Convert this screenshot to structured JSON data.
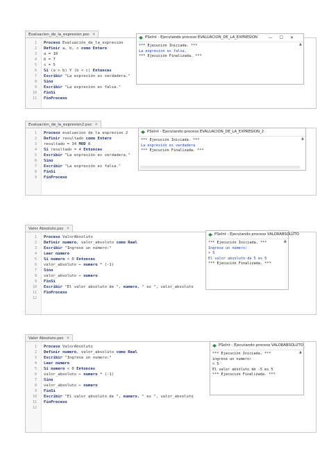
{
  "panels": [
    {
      "tab": "Evaluacion_de_la_expresion.psc",
      "lines": [
        [
          "1",
          [
            [
              "k",
              "Proceso"
            ],
            [
              "t",
              " Evaluación_de_la_expresión"
            ]
          ]
        ],
        [
          "2",
          [
            [
              "t",
              "    "
            ],
            [
              "k",
              "Definir"
            ],
            [
              "t",
              " a, b, c "
            ],
            [
              "k",
              "como Entero"
            ]
          ]
        ],
        [
          "3",
          [
            [
              "t",
              "    a = 10"
            ]
          ]
        ],
        [
          "4",
          [
            [
              "t",
              "    b = 7"
            ]
          ]
        ],
        [
          "5",
          [
            [
              "t",
              "    c = 5"
            ]
          ]
        ],
        [
          "6",
          [
            [
              "t",
              "    "
            ],
            [
              "k",
              "Si"
            ],
            [
              "t",
              " (a > b) Y (b < c) "
            ],
            [
              "k",
              "Entonces"
            ]
          ]
        ],
        [
          "7",
          [
            [
              "t",
              "        "
            ],
            [
              "k",
              "Escribir"
            ],
            [
              "t",
              " \"La expresión es verdadera.\""
            ]
          ]
        ],
        [
          "8",
          [
            [
              "t",
              "    "
            ],
            [
              "k",
              "Sino"
            ]
          ]
        ],
        [
          "9",
          [
            [
              "t",
              "        "
            ],
            [
              "k",
              "Escribir"
            ],
            [
              "t",
              " \"La expresión es falsa.\""
            ]
          ]
        ],
        [
          "10",
          [
            [
              "t",
              "    "
            ],
            [
              "k",
              "FinSi"
            ]
          ]
        ],
        [
          "11",
          [
            [
              "k",
              "FinProceso"
            ]
          ]
        ]
      ],
      "output": {
        "title": "PSeInt - Ejecutando proceso EVALUACION_DE_LA_EXPRESION",
        "lines": [
          [
            "*** Ejecución Iniciada. ***",
            "n"
          ],
          [
            "La expresión es falsa.",
            "b"
          ],
          [
            "*** Ejecución Finalizada. ***",
            "n"
          ]
        ]
      }
    },
    {
      "tab": "Evaluacion_de_la_expresion2.psc",
      "lines": [
        [
          "1",
          [
            [
              "k",
              "Proceso"
            ],
            [
              "t",
              " evaluacion de la expresion 2"
            ]
          ]
        ],
        [
          "2",
          [
            [
              "t",
              "    "
            ],
            [
              "k",
              "Definir"
            ],
            [
              "t",
              " resultado "
            ],
            [
              "k",
              "como Entero"
            ]
          ]
        ],
        [
          "3",
          [
            [
              "t",
              "    resultado = 34 "
            ],
            [
              "k",
              "MOD"
            ],
            [
              "t",
              " 6"
            ]
          ]
        ],
        [
          "4",
          [
            [
              "t",
              "    "
            ],
            [
              "k",
              "Si"
            ],
            [
              "t",
              " resultado = 4 "
            ],
            [
              "k",
              "Entonces"
            ]
          ]
        ],
        [
          "5",
          [
            [
              "t",
              "        "
            ],
            [
              "k",
              "Escribir"
            ],
            [
              "t",
              " \"La expresión es verdadera.\""
            ]
          ]
        ],
        [
          "6",
          [
            [
              "t",
              "    "
            ],
            [
              "k",
              "Sino"
            ]
          ]
        ],
        [
          "7",
          [
            [
              "t",
              "        "
            ],
            [
              "k",
              "Escribir"
            ],
            [
              "t",
              " \"La expresión es falsa.\""
            ]
          ]
        ],
        [
          "8",
          [
            [
              "t",
              "    "
            ],
            [
              "k",
              "FinSi"
            ]
          ]
        ],
        [
          "9",
          [
            [
              "k",
              "FinProceso"
            ]
          ]
        ]
      ],
      "output": {
        "title": "PSeInt - Ejecutando proceso EVALUACION_DE_LA_EXPRESION_2",
        "lines": [
          [
            "*** Ejecución Iniciada. ***",
            "n"
          ],
          [
            "La expresión es verdadera",
            "b"
          ],
          [
            "*** Ejecución Finalizada. ***",
            "n"
          ]
        ]
      }
    },
    {
      "tab": "Valor Absoluto.psc",
      "lines": [
        [
          "1",
          [
            [
              "k",
              "Proceso"
            ],
            [
              "t",
              " ValorAbsoluto"
            ]
          ]
        ],
        [
          "2",
          [
            [
              "t",
              "    "
            ],
            [
              "k",
              "Definir"
            ],
            [
              "t",
              " "
            ],
            [
              "k",
              "numero"
            ],
            [
              "t",
              ", valor_absoluto "
            ],
            [
              "k",
              "como Real"
            ]
          ]
        ],
        [
          "3",
          [
            [
              "t",
              "    "
            ],
            [
              "k",
              "Escribir"
            ],
            [
              "t",
              " \"Ingrese un número:\""
            ]
          ]
        ],
        [
          "4",
          [
            [
              "t",
              "    "
            ],
            [
              "k",
              "Leer numero"
            ]
          ]
        ],
        [
          "5",
          [
            [
              "t",
              "    "
            ],
            [
              "k",
              "Si numero"
            ],
            [
              "t",
              " < 0 "
            ],
            [
              "k",
              "Entonces"
            ]
          ]
        ],
        [
          "6",
          [
            [
              "t",
              "    valor_absoluto ← "
            ],
            [
              "k",
              "numero"
            ],
            [
              "t",
              " * (-1)"
            ]
          ]
        ],
        [
          "7",
          [
            [
              "t",
              "    "
            ],
            [
              "k",
              "Sino"
            ]
          ]
        ],
        [
          "8",
          [
            [
              "t",
              "    valor_absoluto ← "
            ],
            [
              "k",
              "numero"
            ]
          ]
        ],
        [
          "9",
          [
            [
              "t",
              "    "
            ],
            [
              "k",
              "FinSi"
            ]
          ]
        ],
        [
          "10",
          [
            [
              "t",
              "    "
            ],
            [
              "k",
              "Escribir"
            ],
            [
              "t",
              " \"El valor absoluto de \", "
            ],
            [
              "k",
              "numero"
            ],
            [
              "t",
              ", \" es \", valor_absoluto"
            ]
          ]
        ],
        [
          "11",
          [
            [
              "k",
              "FinProceso"
            ]
          ]
        ],
        [
          "12",
          []
        ]
      ],
      "output": {
        "title": "PSeInt - Ejecutando proceso VALORABSOLUTO",
        "lines": [
          [
            "*** Ejecución Iniciada. ***",
            "n"
          ],
          [
            "Ingrese un número:",
            "b"
          ],
          [
            "> 5",
            "b"
          ],
          [
            "El valor absoluto de 5 es 5",
            "b"
          ],
          [
            "*** Ejecución Finalizada. ***",
            "n"
          ]
        ]
      }
    },
    {
      "tab": "Valor Absoluto.psc",
      "lines": [
        [
          "1",
          [
            [
              "k",
              "Proceso"
            ],
            [
              "t",
              " ValorAbsoluto"
            ]
          ]
        ],
        [
          "2",
          [
            [
              "t",
              "    "
            ],
            [
              "k",
              "Definir"
            ],
            [
              "t",
              " "
            ],
            [
              "k",
              "numero"
            ],
            [
              "t",
              ", valor_absoluto "
            ],
            [
              "k",
              "como Real"
            ]
          ]
        ],
        [
          "3",
          [
            [
              "t",
              "    "
            ],
            [
              "k",
              "Escribir"
            ],
            [
              "t",
              " \"Ingrese un numero:\""
            ]
          ]
        ],
        [
          "4",
          [
            [
              "t",
              "    "
            ],
            [
              "k",
              "Leer numero"
            ]
          ]
        ],
        [
          "5",
          [
            [
              "t",
              "    "
            ],
            [
              "k",
              "Si numero"
            ],
            [
              "t",
              " < 0 "
            ],
            [
              "k",
              "Entonces"
            ]
          ]
        ],
        [
          "6",
          [
            [
              "t",
              "    valor_absoluto ← "
            ],
            [
              "k",
              "numero"
            ],
            [
              "t",
              " * (-1)"
            ]
          ]
        ],
        [
          "7",
          [
            [
              "t",
              "    "
            ],
            [
              "k",
              "Sino"
            ]
          ]
        ],
        [
          "8",
          [
            [
              "t",
              "    valor_absoluto ← "
            ],
            [
              "k",
              "numero"
            ]
          ]
        ],
        [
          "9",
          [
            [
              "t",
              "    "
            ],
            [
              "k",
              "FinSi"
            ]
          ]
        ],
        [
          "10",
          [
            [
              "t",
              "    "
            ],
            [
              "k",
              "Escribir"
            ],
            [
              "t",
              " \"El valor absoluto de \", "
            ],
            [
              "k",
              "numero"
            ],
            [
              "t",
              ", \" es \", valor_absoluto"
            ]
          ]
        ],
        [
          "11",
          [
            [
              "k",
              "FinProceso"
            ]
          ]
        ],
        [
          "12",
          []
        ]
      ],
      "output": {
        "title": "PSeInt - Ejecutando proceso VALORABSOLUTO",
        "lines": [
          [
            "*** Ejecución Iniciada. ***",
            "n"
          ],
          [
            "ingrese un numero:",
            "n"
          ],
          [
            ">  5",
            "n"
          ],
          [
            "El valor absoluto de -5 es 5",
            "n"
          ],
          [
            "*** Ejecución Finalizada. ***",
            "n"
          ]
        ]
      }
    }
  ],
  "window_controls": [
    "—",
    "☐",
    "✕"
  ],
  "tab_close": "✕",
  "icons": {
    "tab_close": "close-icon",
    "pseint": "pseint-icon",
    "scroll_up": "arrow-up-icon",
    "scroll_down": "arrow-down-icon"
  }
}
